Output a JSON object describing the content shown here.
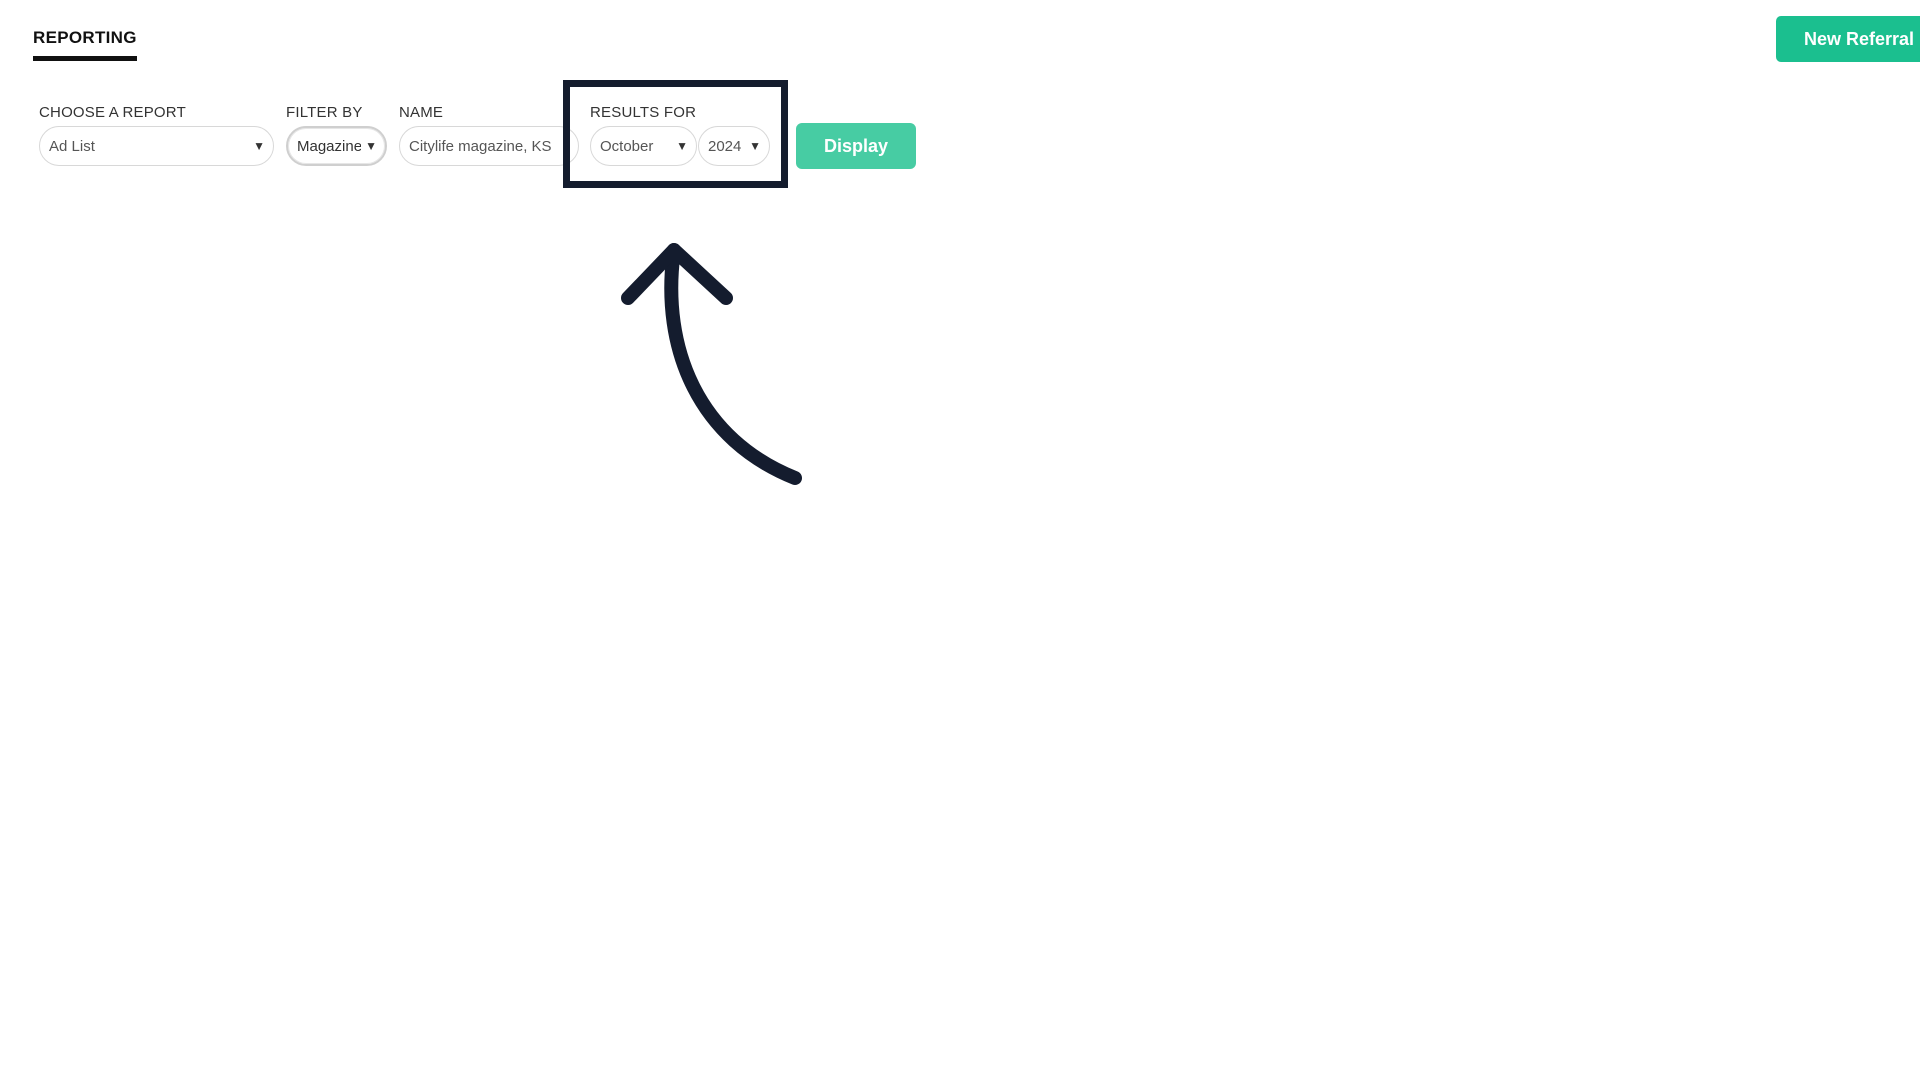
{
  "header": {
    "tab_label": "REPORTING",
    "new_referral_label": "New Referral"
  },
  "filters": {
    "report": {
      "label": "CHOOSE A REPORT",
      "value": "Ad List"
    },
    "filter_by": {
      "label": "FILTER BY",
      "value": "Magazine"
    },
    "name": {
      "label": "NAME",
      "value": "Citylife magazine, KS"
    },
    "results_for": {
      "label": "RESULTS FOR",
      "month": "October",
      "year": "2024"
    }
  },
  "display_label": "Display",
  "icons": {
    "caret": "▼",
    "annotation": "curved-arrow-up-icon"
  },
  "colors": {
    "accent": "#1bbf8f",
    "display_button": "#47cca3",
    "annotation": "#141c2e"
  }
}
